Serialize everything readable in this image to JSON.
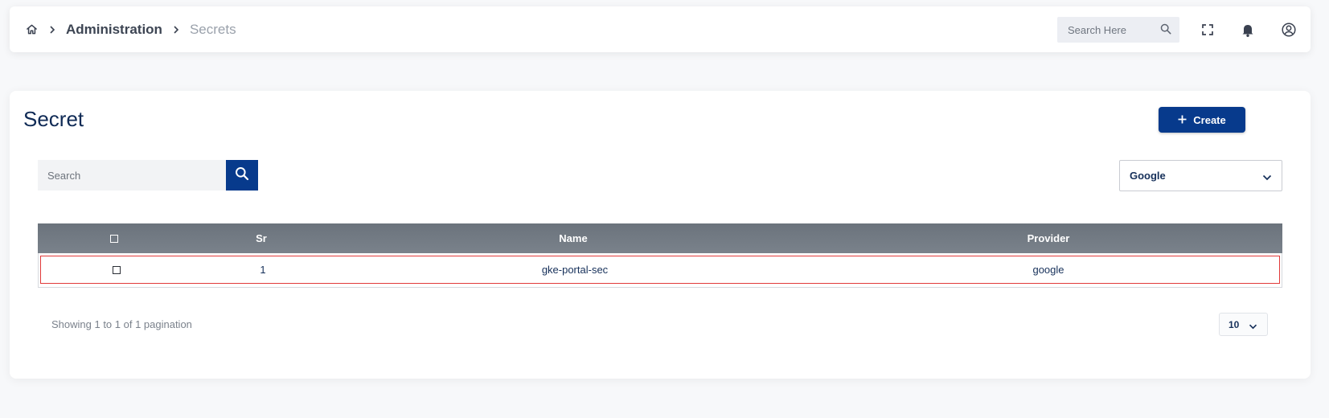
{
  "breadcrumb": {
    "home_icon": "home-icon",
    "items": [
      "Administration",
      "Secrets"
    ]
  },
  "header": {
    "search_placeholder": "Search Here",
    "icons": [
      "search-icon",
      "fullscreen-icon",
      "bell-icon",
      "user-circle-icon"
    ]
  },
  "page": {
    "title": "Secret",
    "create_label": "Create",
    "search_placeholder": "Search",
    "provider_filter": "Google"
  },
  "table": {
    "columns": [
      "Sr",
      "Name",
      "Provider"
    ],
    "rows": [
      {
        "sr": "1",
        "name": "gke-portal-sec",
        "provider": "google"
      }
    ]
  },
  "pagination": {
    "summary": "Showing 1 to 1 of 1 pagination",
    "page_size": "10"
  },
  "colors": {
    "primary": "#073a8c",
    "table_header": "#727a83",
    "row_highlight_border": "#e13a3a"
  }
}
